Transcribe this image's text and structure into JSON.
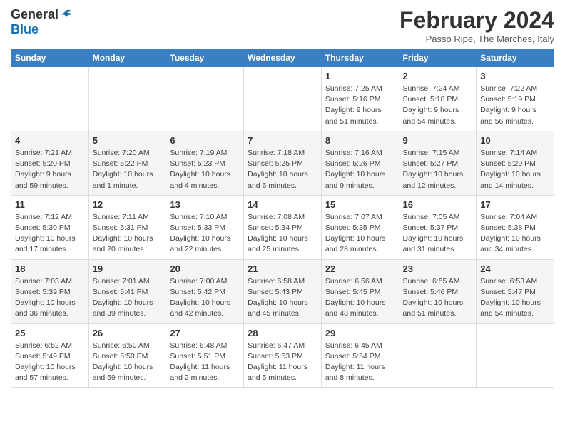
{
  "logo": {
    "general": "General",
    "blue": "Blue"
  },
  "title": "February 2024",
  "location": "Passo Ripe, The Marches, Italy",
  "days_of_week": [
    "Sunday",
    "Monday",
    "Tuesday",
    "Wednesday",
    "Thursday",
    "Friday",
    "Saturday"
  ],
  "weeks": [
    [
      {
        "day": "",
        "sunrise": "",
        "sunset": "",
        "daylight": "",
        "empty": true
      },
      {
        "day": "",
        "sunrise": "",
        "sunset": "",
        "daylight": "",
        "empty": true
      },
      {
        "day": "",
        "sunrise": "",
        "sunset": "",
        "daylight": "",
        "empty": true
      },
      {
        "day": "",
        "sunrise": "",
        "sunset": "",
        "daylight": "",
        "empty": true
      },
      {
        "day": "1",
        "sunrise": "Sunrise: 7:25 AM",
        "sunset": "Sunset: 5:16 PM",
        "daylight": "Daylight: 9 hours and 51 minutes.",
        "empty": false
      },
      {
        "day": "2",
        "sunrise": "Sunrise: 7:24 AM",
        "sunset": "Sunset: 5:18 PM",
        "daylight": "Daylight: 9 hours and 54 minutes.",
        "empty": false
      },
      {
        "day": "3",
        "sunrise": "Sunrise: 7:22 AM",
        "sunset": "Sunset: 5:19 PM",
        "daylight": "Daylight: 9 hours and 56 minutes.",
        "empty": false
      }
    ],
    [
      {
        "day": "4",
        "sunrise": "Sunrise: 7:21 AM",
        "sunset": "Sunset: 5:20 PM",
        "daylight": "Daylight: 9 hours and 59 minutes.",
        "empty": false
      },
      {
        "day": "5",
        "sunrise": "Sunrise: 7:20 AM",
        "sunset": "Sunset: 5:22 PM",
        "daylight": "Daylight: 10 hours and 1 minute.",
        "empty": false
      },
      {
        "day": "6",
        "sunrise": "Sunrise: 7:19 AM",
        "sunset": "Sunset: 5:23 PM",
        "daylight": "Daylight: 10 hours and 4 minutes.",
        "empty": false
      },
      {
        "day": "7",
        "sunrise": "Sunrise: 7:18 AM",
        "sunset": "Sunset: 5:25 PM",
        "daylight": "Daylight: 10 hours and 6 minutes.",
        "empty": false
      },
      {
        "day": "8",
        "sunrise": "Sunrise: 7:16 AM",
        "sunset": "Sunset: 5:26 PM",
        "daylight": "Daylight: 10 hours and 9 minutes.",
        "empty": false
      },
      {
        "day": "9",
        "sunrise": "Sunrise: 7:15 AM",
        "sunset": "Sunset: 5:27 PM",
        "daylight": "Daylight: 10 hours and 12 minutes.",
        "empty": false
      },
      {
        "day": "10",
        "sunrise": "Sunrise: 7:14 AM",
        "sunset": "Sunset: 5:29 PM",
        "daylight": "Daylight: 10 hours and 14 minutes.",
        "empty": false
      }
    ],
    [
      {
        "day": "11",
        "sunrise": "Sunrise: 7:12 AM",
        "sunset": "Sunset: 5:30 PM",
        "daylight": "Daylight: 10 hours and 17 minutes.",
        "empty": false
      },
      {
        "day": "12",
        "sunrise": "Sunrise: 7:11 AM",
        "sunset": "Sunset: 5:31 PM",
        "daylight": "Daylight: 10 hours and 20 minutes.",
        "empty": false
      },
      {
        "day": "13",
        "sunrise": "Sunrise: 7:10 AM",
        "sunset": "Sunset: 5:33 PM",
        "daylight": "Daylight: 10 hours and 22 minutes.",
        "empty": false
      },
      {
        "day": "14",
        "sunrise": "Sunrise: 7:08 AM",
        "sunset": "Sunset: 5:34 PM",
        "daylight": "Daylight: 10 hours and 25 minutes.",
        "empty": false
      },
      {
        "day": "15",
        "sunrise": "Sunrise: 7:07 AM",
        "sunset": "Sunset: 5:35 PM",
        "daylight": "Daylight: 10 hours and 28 minutes.",
        "empty": false
      },
      {
        "day": "16",
        "sunrise": "Sunrise: 7:05 AM",
        "sunset": "Sunset: 5:37 PM",
        "daylight": "Daylight: 10 hours and 31 minutes.",
        "empty": false
      },
      {
        "day": "17",
        "sunrise": "Sunrise: 7:04 AM",
        "sunset": "Sunset: 5:38 PM",
        "daylight": "Daylight: 10 hours and 34 minutes.",
        "empty": false
      }
    ],
    [
      {
        "day": "18",
        "sunrise": "Sunrise: 7:03 AM",
        "sunset": "Sunset: 5:39 PM",
        "daylight": "Daylight: 10 hours and 36 minutes.",
        "empty": false
      },
      {
        "day": "19",
        "sunrise": "Sunrise: 7:01 AM",
        "sunset": "Sunset: 5:41 PM",
        "daylight": "Daylight: 10 hours and 39 minutes.",
        "empty": false
      },
      {
        "day": "20",
        "sunrise": "Sunrise: 7:00 AM",
        "sunset": "Sunset: 5:42 PM",
        "daylight": "Daylight: 10 hours and 42 minutes.",
        "empty": false
      },
      {
        "day": "21",
        "sunrise": "Sunrise: 6:58 AM",
        "sunset": "Sunset: 5:43 PM",
        "daylight": "Daylight: 10 hours and 45 minutes.",
        "empty": false
      },
      {
        "day": "22",
        "sunrise": "Sunrise: 6:56 AM",
        "sunset": "Sunset: 5:45 PM",
        "daylight": "Daylight: 10 hours and 48 minutes.",
        "empty": false
      },
      {
        "day": "23",
        "sunrise": "Sunrise: 6:55 AM",
        "sunset": "Sunset: 5:46 PM",
        "daylight": "Daylight: 10 hours and 51 minutes.",
        "empty": false
      },
      {
        "day": "24",
        "sunrise": "Sunrise: 6:53 AM",
        "sunset": "Sunset: 5:47 PM",
        "daylight": "Daylight: 10 hours and 54 minutes.",
        "empty": false
      }
    ],
    [
      {
        "day": "25",
        "sunrise": "Sunrise: 6:52 AM",
        "sunset": "Sunset: 5:49 PM",
        "daylight": "Daylight: 10 hours and 57 minutes.",
        "empty": false
      },
      {
        "day": "26",
        "sunrise": "Sunrise: 6:50 AM",
        "sunset": "Sunset: 5:50 PM",
        "daylight": "Daylight: 10 hours and 59 minutes.",
        "empty": false
      },
      {
        "day": "27",
        "sunrise": "Sunrise: 6:48 AM",
        "sunset": "Sunset: 5:51 PM",
        "daylight": "Daylight: 11 hours and 2 minutes.",
        "empty": false
      },
      {
        "day": "28",
        "sunrise": "Sunrise: 6:47 AM",
        "sunset": "Sunset: 5:53 PM",
        "daylight": "Daylight: 11 hours and 5 minutes.",
        "empty": false
      },
      {
        "day": "29",
        "sunrise": "Sunrise: 6:45 AM",
        "sunset": "Sunset: 5:54 PM",
        "daylight": "Daylight: 11 hours and 8 minutes.",
        "empty": false
      },
      {
        "day": "",
        "sunrise": "",
        "sunset": "",
        "daylight": "",
        "empty": true
      },
      {
        "day": "",
        "sunrise": "",
        "sunset": "",
        "daylight": "",
        "empty": true
      }
    ]
  ]
}
